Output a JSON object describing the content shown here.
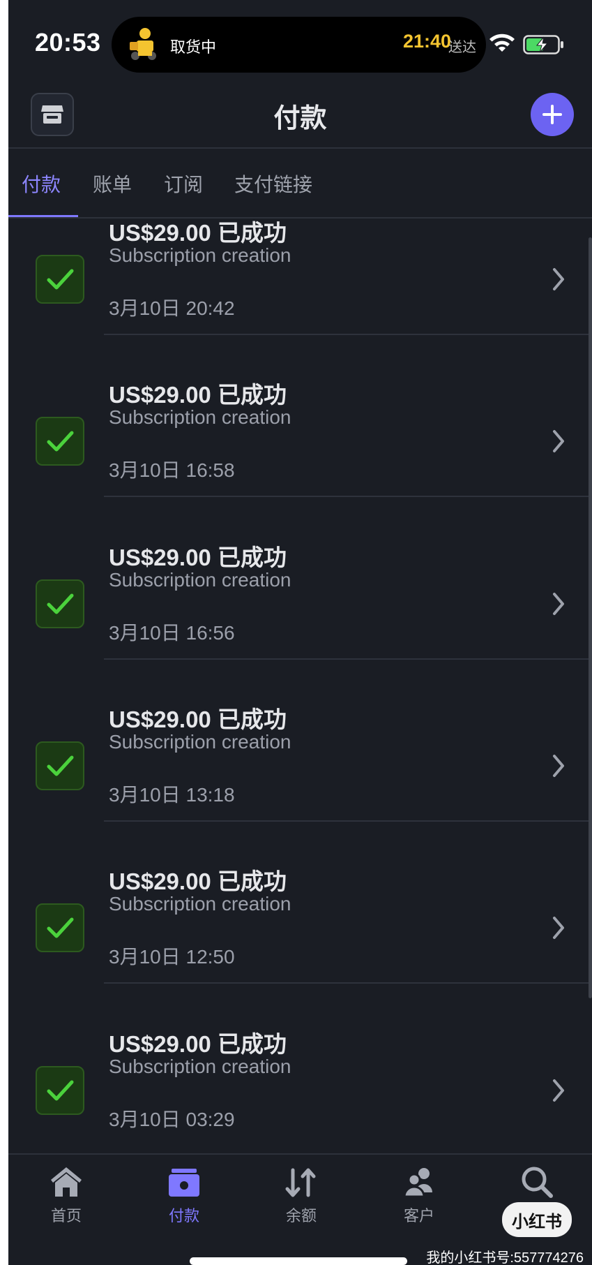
{
  "status_bar": {
    "time": "20:53",
    "live_activity": {
      "status": "取货中",
      "eta_time": "21:40",
      "eta_label": "送达"
    }
  },
  "header": {
    "title": "付款",
    "store_icon": "storefront-icon",
    "add_icon": "plus-icon",
    "accent_color": "#6c63f2"
  },
  "tabs": [
    {
      "label": "付款",
      "active": true
    },
    {
      "label": "账单",
      "active": false
    },
    {
      "label": "订阅",
      "active": false
    },
    {
      "label": "支付链接",
      "active": false
    }
  ],
  "payments": [
    {
      "amount": "US$29.00 已成功",
      "description": "Subscription creation",
      "date": "3月10日 20:42"
    },
    {
      "amount": "US$29.00 已成功",
      "description": "Subscription creation",
      "date": "3月10日 16:58"
    },
    {
      "amount": "US$29.00 已成功",
      "description": "Subscription creation",
      "date": "3月10日 16:56"
    },
    {
      "amount": "US$29.00 已成功",
      "description": "Subscription creation",
      "date": "3月10日 13:18"
    },
    {
      "amount": "US$29.00 已成功",
      "description": "Subscription creation",
      "date": "3月10日 12:50"
    },
    {
      "amount": "US$29.00 已成功",
      "description": "Subscription creation",
      "date": "3月10日 03:29"
    }
  ],
  "nav": [
    {
      "label": "首页",
      "icon": "home-icon",
      "active": false
    },
    {
      "label": "付款",
      "icon": "payments-icon",
      "active": true
    },
    {
      "label": "余额",
      "icon": "transfer-arrows-icon",
      "active": false
    },
    {
      "label": "客户",
      "icon": "customers-icon",
      "active": false
    },
    {
      "label": "",
      "icon": "search-icon",
      "active": false
    }
  ],
  "watermark": {
    "logo": "小红书",
    "text": "我的小红书号:557774276"
  }
}
